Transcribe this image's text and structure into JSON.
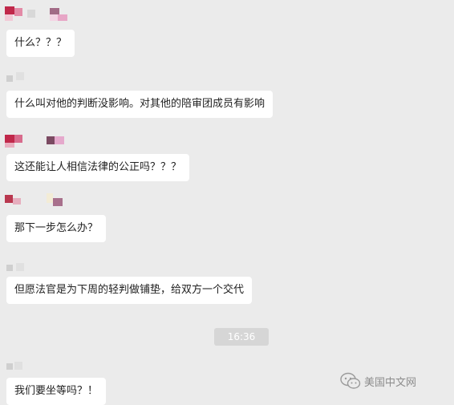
{
  "messages": [
    {
      "text": "什么？？？"
    },
    {
      "text": "什么叫对他的判断没影响。对其他的陪审团成员有影响"
    },
    {
      "text": "这还能让人相信法律的公正吗？？？"
    },
    {
      "text": "那下一步怎么办？"
    },
    {
      "text": "但愿法官是为下周的轻判做铺垫，给双方一个交代"
    },
    {
      "text": "我们要坐等吗？！"
    }
  ],
  "timestamp": "16:36",
  "watermark": {
    "label": "美国中文网",
    "icon": "wechat-icon"
  },
  "colors": {
    "background": "#ebebeb",
    "bubble": "#ffffff",
    "timestamp_bg": "#d6d6d6",
    "watermark": "#8c8c8c"
  }
}
